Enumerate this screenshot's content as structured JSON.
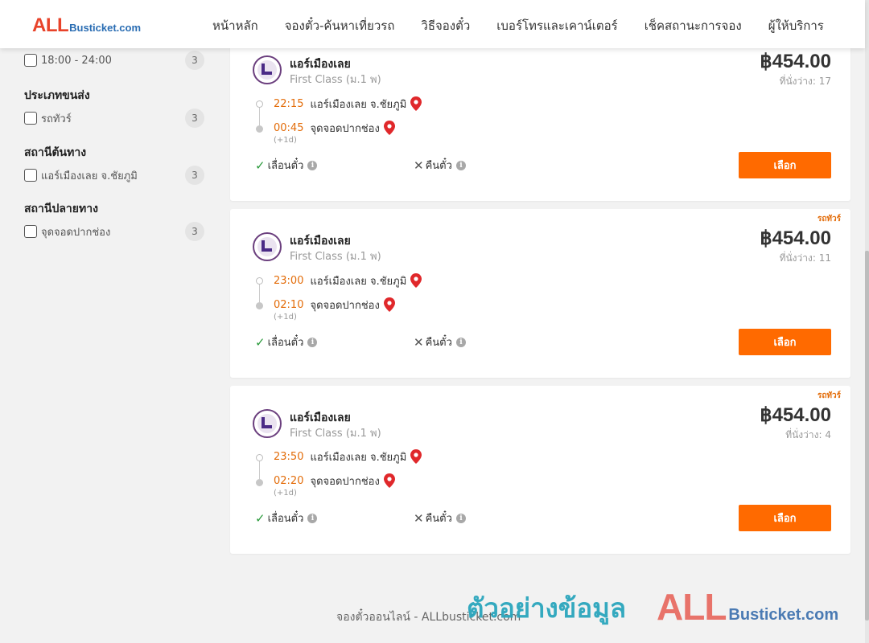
{
  "header": {
    "logo_all": "ALL",
    "logo_rest": "Busticket.com",
    "nav": [
      "หน้าหลัก",
      "จองตั๋ว-ค้นหาเที่ยวรถ",
      "วิธีจองตั๋ว",
      "เบอร์โทรและเคาน์เตอร์",
      "เช็คสถานะการจอง",
      "ผู้ให้บริการ"
    ]
  },
  "sidebar": {
    "time_option": {
      "label": "18:00 - 24:00",
      "count": "3"
    },
    "transport_type": {
      "title": "ประเภทขนส่ง",
      "label": "รถทัวร์",
      "count": "3"
    },
    "origin": {
      "title": "สถานีต้นทาง",
      "label": "แอร์เมืองเลย จ.ชัยภูมิ",
      "count": "3"
    },
    "destination": {
      "title": "สถานีปลายทาง",
      "label": "จุดจอดปากช่อง",
      "count": "3"
    }
  },
  "trips": [
    {
      "badge": "",
      "operator": "แอร์เมืองเลย",
      "class": "First Class (ม.1 พ)",
      "price": "฿454.00",
      "seats": "ที่นั่งว่าง: 17",
      "depart_time": "22:15",
      "depart_place": "แอร์เมืองเลย จ.ชัยภูมิ",
      "arrive_time": "00:45",
      "arrive_place": "จุดจอดปากช่อง",
      "next_day": "(+1d)",
      "reschedule": "เลื่อนตั๋ว",
      "refund": "คืนตั๋ว",
      "select": "เลือก"
    },
    {
      "badge": "รถทัวร์",
      "operator": "แอร์เมืองเลย",
      "class": "First Class (ม.1 พ)",
      "price": "฿454.00",
      "seats": "ที่นั่งว่าง: 11",
      "depart_time": "23:00",
      "depart_place": "แอร์เมืองเลย จ.ชัยภูมิ",
      "arrive_time": "02:10",
      "arrive_place": "จุดจอดปากช่อง",
      "next_day": "(+1d)",
      "reschedule": "เลื่อนตั๋ว",
      "refund": "คืนตั๋ว",
      "select": "เลือก"
    },
    {
      "badge": "รถทัวร์",
      "operator": "แอร์เมืองเลย",
      "class": "First Class (ม.1 พ)",
      "price": "฿454.00",
      "seats": "ที่นั่งว่าง: 4",
      "depart_time": "23:50",
      "depart_place": "แอร์เมืองเลย จ.ชัยภูมิ",
      "arrive_time": "02:20",
      "arrive_place": "จุดจอดปากช่อง",
      "next_day": "(+1d)",
      "reschedule": "เลื่อนตั๋ว",
      "refund": "คืนตั๋ว",
      "select": "เลือก"
    }
  ],
  "footer": {
    "text": "จองตั๋วออนไลน์ - ALLbusticket.com"
  },
  "watermark": {
    "thai": "ตัวอย่างข้อมูล",
    "logo_all": "ALL",
    "logo_rest": "Busticket.com"
  },
  "colors": {
    "accent": "#ff6a00",
    "time": "#e36c09",
    "logo_red": "#e8432a",
    "logo_blue": "#2a6db3",
    "check_green": "#2a9a3b"
  },
  "icons": {
    "pin": "map-pin-icon",
    "check": "check-icon",
    "cross": "x-icon",
    "info": "info-icon"
  }
}
